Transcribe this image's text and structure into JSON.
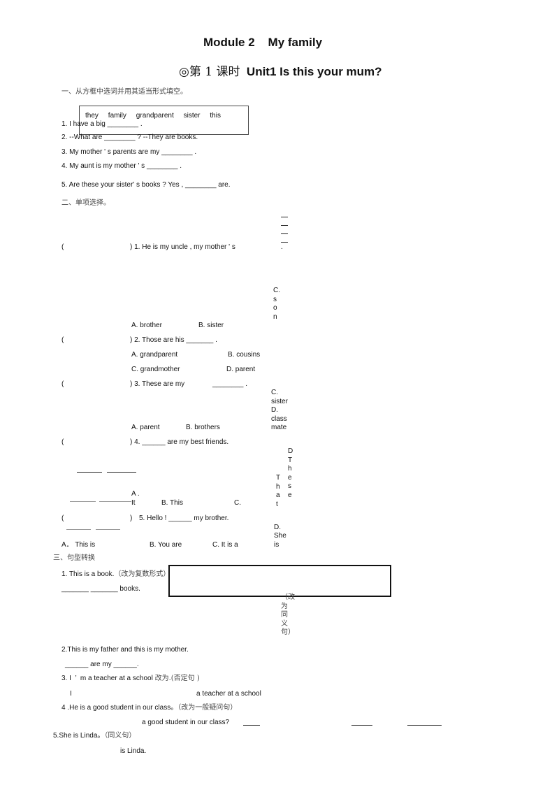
{
  "title": "Module 2    My family",
  "subtitle_prefix": "◎第 1 课时",
  "subtitle": "Unit1 Is this your mum?",
  "section1": {
    "heading": "一、从方框中选词并用其适当形式填空。",
    "word_box": "they     family     grandparent     sister     this",
    "questions": [
      "1. I have a big ________ .",
      "2. --What are ________ ? --They are books.",
      "3. My mother ' s parents are my ________ .",
      "4. My aunt is my mother ' s ________ .",
      "5. Are these your sister' s books ? Yes , ________ are."
    ]
  },
  "section2": {
    "heading": "二、单项选择。",
    "paren_open": "(",
    "q1": {
      "stem": ") 1. He is my uncle , my mother ' s",
      "dot": ".",
      "a": "A. brother",
      "b": "B. sister",
      "c": "C.son"
    },
    "q2": {
      "stem": ") 2. Those are his _______ .",
      "a": "A. grandparent",
      "b": "B. cousins",
      "c": "C. grandmother",
      "d": "D. parent"
    },
    "q3": {
      "stem": ") 3. These are my",
      "blank": "________ .",
      "a": "A. parent",
      "b": "B. brothers",
      "c": "C.",
      "c2": "sister",
      "d": "D.",
      "d2": "class",
      "d3": "mate"
    },
    "q4": {
      "stem": ") 4. ______ are my best friends.",
      "a": "A .",
      "a2": "It",
      "b": "B. This",
      "c": "C.",
      "c_val": "That",
      "d": "D.These"
    },
    "q5": {
      "paren_close": ")",
      "stem": "5. Hello ! ______ my brother.",
      "a": "A． This is",
      "b": "B. You are",
      "c": "C. It is a",
      "d": "D.",
      "d2": "She",
      "d3": "is"
    }
  },
  "section3": {
    "heading": "三、句型转换",
    "q1": {
      "stem": "1. This is a book.",
      "hint": "（改为复数形式）",
      "answer": "_______ _______ books."
    },
    "side_hint": "（改为同义句）",
    "q2": {
      "stem": "2.This is my father and this is my mother.",
      "answer": "______ are my ______."
    },
    "q3": {
      "stem": "3. I  ’  m a teacher at a school",
      "hint": "改为.(否定句 )",
      "answer_start": "I",
      "answer_end": "a teacher at a school"
    },
    "q4": {
      "stem": "4 .He is a good student in our class。",
      "hint": "（改为一般疑问句）",
      "answer": "a good student in our class?"
    },
    "q5": {
      "stem": "5.She is Linda。",
      "hint": "（同义句）",
      "answer": "is Linda."
    }
  }
}
